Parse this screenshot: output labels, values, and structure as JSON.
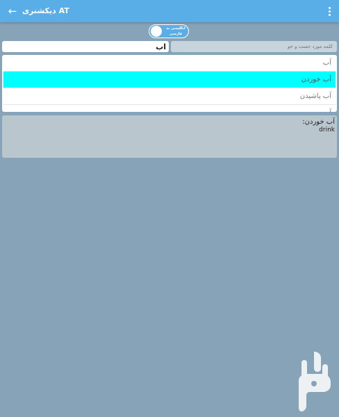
{
  "appbar": {
    "title": "دیکشنری AT",
    "back_icon": "arrow-left-icon",
    "menu_icon": "more-vertical-icon",
    "color": "#5aaee8"
  },
  "toggle": {
    "line1": "انگلیسی به",
    "line2": "فارسی",
    "state": "off"
  },
  "search": {
    "value": "اب",
    "hint": "کلمه مورد جست و جو"
  },
  "results": {
    "items": [
      "آب",
      "آب خوردن",
      "آب پاشیدن",
      "آب ..."
    ],
    "selected_index": 1,
    "highlight_color": "#00ffff"
  },
  "detail": {
    "word": "آب خوردن:",
    "translation": "drink"
  },
  "colors": {
    "background": "#87a3b8"
  }
}
